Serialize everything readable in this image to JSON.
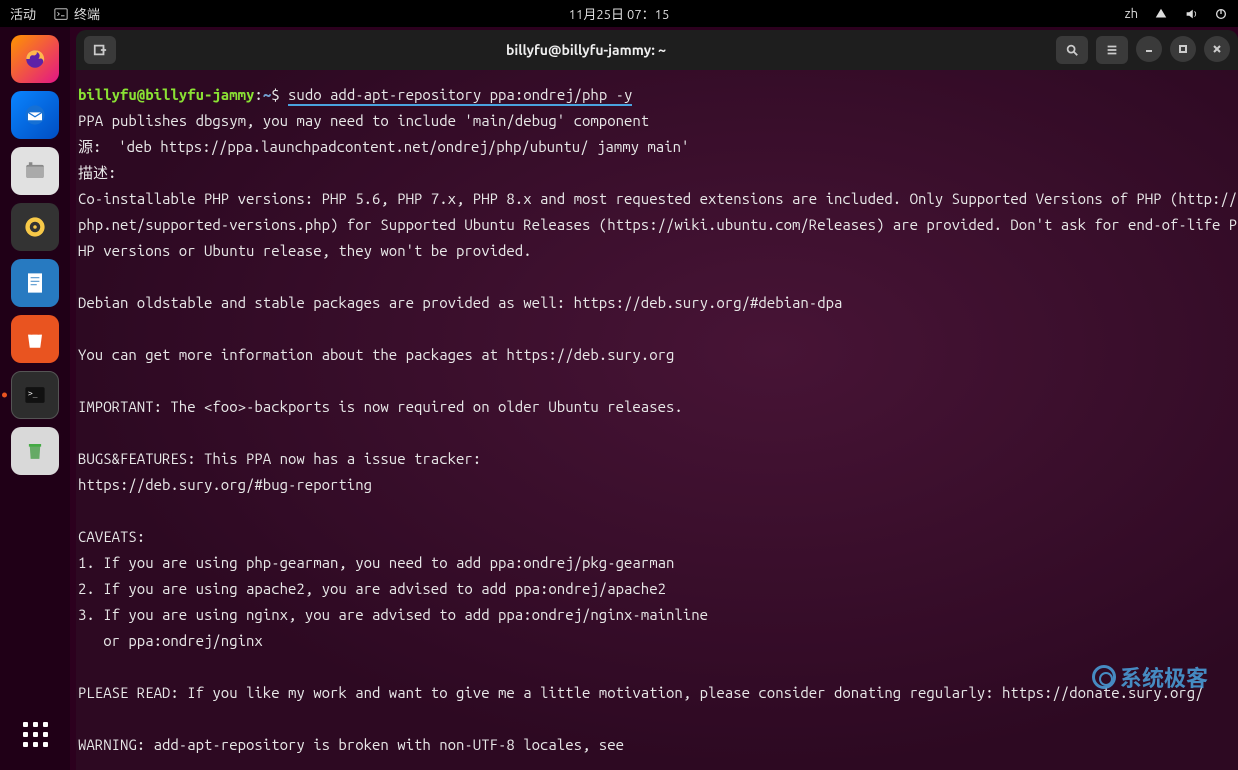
{
  "topbar": {
    "activities": "活动",
    "app_name": "终端",
    "datetime": "11月25日 07：15",
    "lang": "zh"
  },
  "dock": {
    "items": [
      {
        "name": "firefox",
        "label": "Firefox"
      },
      {
        "name": "thunderbird",
        "label": "Thunderbird"
      },
      {
        "name": "files",
        "label": "Files"
      },
      {
        "name": "rhythmbox",
        "label": "Rhythmbox"
      },
      {
        "name": "writer",
        "label": "LibreOffice Writer"
      },
      {
        "name": "software",
        "label": "Ubuntu Software"
      },
      {
        "name": "terminal",
        "label": "Terminal",
        "running": true
      },
      {
        "name": "trash",
        "label": "Trash"
      }
    ]
  },
  "window": {
    "title": "billyfu@billyfu-jammy: ~"
  },
  "terminal": {
    "prompt_user": "billyfu@billyfu-jammy",
    "prompt_sep": ":",
    "prompt_path": "~",
    "prompt_symbol": "$",
    "command": "sudo add-apt-repository ppa:ondrej/php -y",
    "output": "PPA publishes dbgsym, you may need to include 'main/debug' component\n源:  'deb https://ppa.launchpadcontent.net/ondrej/php/ubuntu/ jammy main'\n描述:\nCo-installable PHP versions: PHP 5.6, PHP 7.x, PHP 8.x and most requested extensions are included. Only Supported Versions of PHP (http://php.net/supported-versions.php) for Supported Ubuntu Releases (https://wiki.ubuntu.com/Releases) are provided. Don't ask for end-of-life PHP versions or Ubuntu release, they won't be provided.\n\nDebian oldstable and stable packages are provided as well: https://deb.sury.org/#debian-dpa\n\nYou can get more information about the packages at https://deb.sury.org\n\nIMPORTANT: The <foo>-backports is now required on older Ubuntu releases.\n\nBUGS&FEATURES: This PPA now has a issue tracker:\nhttps://deb.sury.org/#bug-reporting\n\nCAVEATS:\n1. If you are using php-gearman, you need to add ppa:ondrej/pkg-gearman\n2. If you are using apache2, you are advised to add ppa:ondrej/apache2\n3. If you are using nginx, you are advised to add ppa:ondrej/nginx-mainline\n   or ppa:ondrej/nginx\n\nPLEASE READ: If you like my work and want to give me a little motivation, please consider donating regularly: https://donate.sury.org/\n\nWARNING: add-apt-repository is broken with non-UTF-8 locales, see"
  },
  "watermark": "系统极客"
}
